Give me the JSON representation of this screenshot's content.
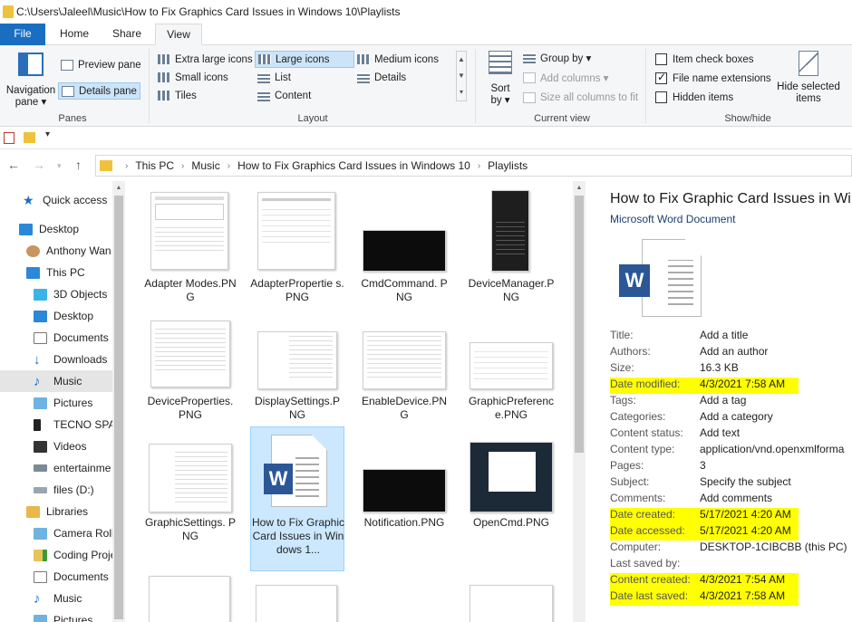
{
  "window": {
    "title": "C:\\Users\\Jaleel\\Music\\How to Fix Graphics Card Issues in Windows 10\\Playlists"
  },
  "ribbon_tabs": [
    "File",
    "Home",
    "Share",
    "View"
  ],
  "ribbon": {
    "panes": {
      "navigation_pane": "Navigation",
      "navigation_pane2": "pane ▾",
      "preview_pane": "Preview pane",
      "details_pane": "Details pane",
      "label": "Panes"
    },
    "layout": {
      "items": [
        "Extra large icons",
        "Large icons",
        "Medium icons",
        "Small icons",
        "List",
        "Details",
        "Tiles",
        "Content"
      ],
      "selected": "Large icons",
      "label": "Layout"
    },
    "current_view": {
      "sort_by": "Sort",
      "sort_by2": "by ▾",
      "group_by": "Group by ▾",
      "add_columns": "Add columns ▾",
      "size_columns": "Size all columns to fit",
      "label": "Current view"
    },
    "show_hide": {
      "item_check_boxes": "Item check boxes",
      "file_name_extensions": "File name extensions",
      "hidden_items": "Hidden items",
      "hide_selected": "Hide selected",
      "hide_selected2": "items",
      "label": "Show/hide"
    }
  },
  "address": {
    "crumbs": [
      "This PC",
      "Music",
      "How to Fix Graphics Card Issues in Windows 10",
      "Playlists"
    ]
  },
  "nav_pane": {
    "items": [
      "Quick access",
      "Desktop",
      "Anthony Wan",
      "This PC",
      "3D Objects",
      "Desktop",
      "Documents",
      "Downloads",
      "Music",
      "Pictures",
      "TECNO SPAR",
      "Videos",
      "entertainme",
      "files (D:)",
      "Libraries",
      "Camera Roll",
      "Coding Proje",
      "Documents",
      "Music",
      "Pictures"
    ],
    "selected": "Music"
  },
  "files": [
    {
      "name": "Adapter Modes.PNG"
    },
    {
      "name": "AdapterPropertie s.PNG"
    },
    {
      "name": "CmdCommand. PNG"
    },
    {
      "name": "DeviceManager.P NG"
    },
    {
      "name": "DeviceProperties. PNG"
    },
    {
      "name": "DisplaySettings.P NG"
    },
    {
      "name": "EnableDevice.PN G"
    },
    {
      "name": "GraphicPreferenc e.PNG"
    },
    {
      "name": "GraphicSettings. PNG"
    },
    {
      "name": "How to Fix Graphic Card Issues in Windows 1..."
    },
    {
      "name": "Notification.PNG"
    },
    {
      "name": "OpenCmd.PNG"
    }
  ],
  "details": {
    "title": "How to Fix Graphic Card Issues in Windo",
    "type": "Microsoft Word Document",
    "icon": "word-document-icon",
    "word_letter": "W",
    "props": [
      {
        "k": "Title:",
        "v": "Add a title",
        "hl": false
      },
      {
        "k": "Authors:",
        "v": "Add an author",
        "hl": false
      },
      {
        "k": "Size:",
        "v": "16.3 KB",
        "hl": false
      },
      {
        "k": "Date modified:",
        "v": "4/3/2021 7:58 AM",
        "hl": true
      },
      {
        "k": "Tags:",
        "v": "Add a tag",
        "hl": false
      },
      {
        "k": "Categories:",
        "v": "Add a category",
        "hl": false
      },
      {
        "k": "Content status:",
        "v": "Add text",
        "hl": false
      },
      {
        "k": "Content type:",
        "v": "application/vnd.openxmlforma",
        "hl": false
      },
      {
        "k": "Pages:",
        "v": "3",
        "hl": false
      },
      {
        "k": "Subject:",
        "v": "Specify the subject",
        "hl": false
      },
      {
        "k": "Comments:",
        "v": "Add comments",
        "hl": false
      },
      {
        "k": "Date created:",
        "v": "5/17/2021 4:20 AM",
        "hl": true
      },
      {
        "k": "Date accessed:",
        "v": "5/17/2021 4:20 AM",
        "hl": true
      },
      {
        "k": "Computer:",
        "v": "DESKTOP-1CIBCBB (this PC)",
        "hl": false
      },
      {
        "k": "Last saved by:",
        "v": "",
        "hl": false
      },
      {
        "k": "Content created:",
        "v": "4/3/2021 7:54 AM",
        "hl": true
      },
      {
        "k": "Date last saved:",
        "v": "4/3/2021 7:58 AM",
        "hl": true
      }
    ]
  },
  "colors": {
    "accent": "#1a6ec1",
    "highlight": "#ffff00",
    "selection": "#cce8ff",
    "word_blue": "#2b5797"
  }
}
